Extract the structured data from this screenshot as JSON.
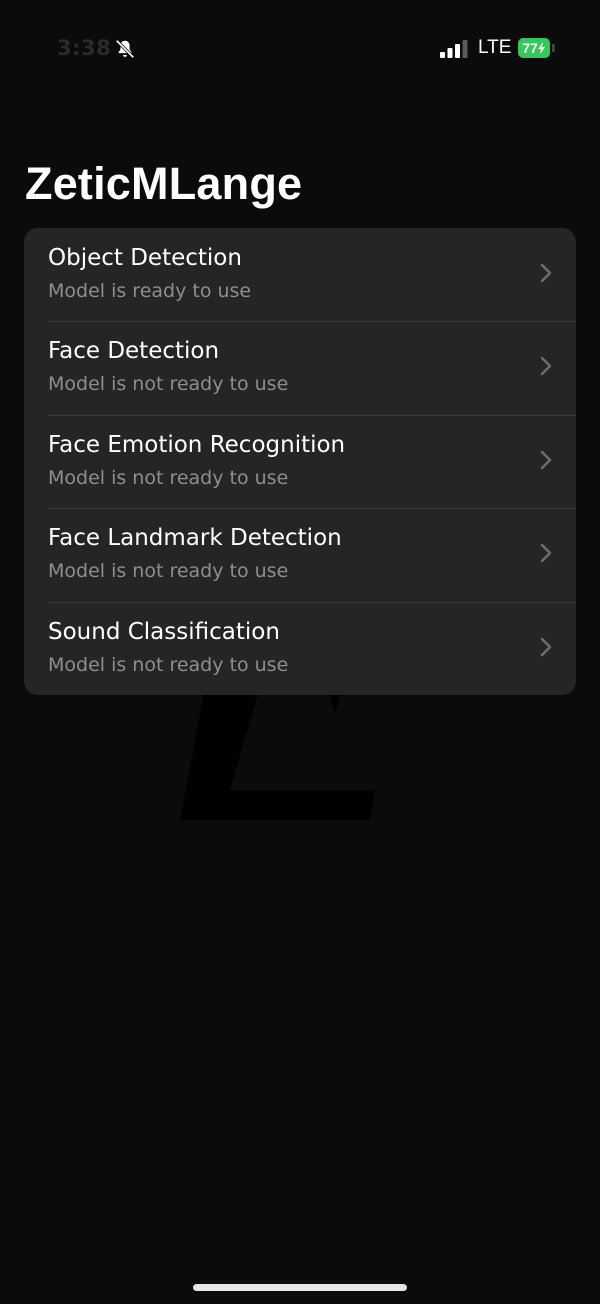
{
  "status_bar": {
    "time": "3:38",
    "network": "LTE",
    "battery": "77"
  },
  "app": {
    "title": "ZeticMLange"
  },
  "icons": {
    "bell": "bell-slash-icon",
    "signal": "cellular-signal-icon",
    "battery": "battery-charging-icon",
    "chevron": "chevron-right-icon"
  },
  "colors": {
    "background": "#0b0b0b",
    "card": "#28282a",
    "subtitle": "#8d8d92",
    "battery": "#34c759"
  },
  "models": [
    {
      "title": "Object Detection",
      "status": "Model is ready to use"
    },
    {
      "title": "Face Detection",
      "status": "Model is not ready to use"
    },
    {
      "title": "Face Emotion Recognition",
      "status": "Model is not ready to use"
    },
    {
      "title": "Face Landmark Detection",
      "status": "Model is not ready to use"
    },
    {
      "title": "Sound Classification",
      "status": "Model is not ready to use"
    }
  ]
}
